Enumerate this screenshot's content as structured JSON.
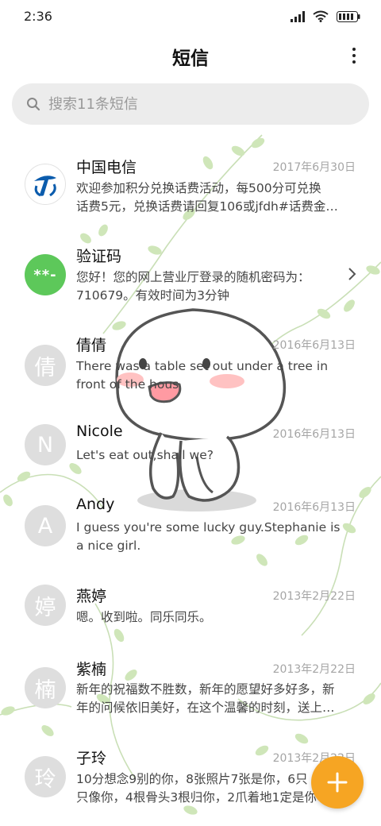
{
  "status": {
    "time": "2:36"
  },
  "header": {
    "title": "短信"
  },
  "search": {
    "placeholder": "搜索11条短信"
  },
  "colors": {
    "accent": "#f6a523",
    "verification": "#5dc85a",
    "avatar_gray": "#dedede"
  },
  "messages": [
    {
      "name": "中国电信",
      "date": "2017年6月30日",
      "line1": "欢迎参加积分兑换话费活动，每500分可兑换",
      "line2": "话费5元，兑换话费请回复106或jfdh#话费金…",
      "avatar": "china-telecom-logo"
    },
    {
      "name": "验证码",
      "date": "",
      "line1": "您好！您的网上营业厅登录的随机密码为：",
      "line2": "710679。有效时间为3分钟",
      "avatar": "**-"
    },
    {
      "name": "倩倩",
      "date": "2016年6月13日",
      "line1": "There was a table set out under a tree in",
      "line2": "front of the hous",
      "avatar": "倩"
    },
    {
      "name": "Nicole",
      "date": "2016年6月13日",
      "line1": "Let's eat out,shall we?",
      "line2": "",
      "avatar": "N"
    },
    {
      "name": "Andy",
      "date": "2016年6月13日",
      "line1": "I guess you're some lucky guy.Stephanie is",
      "line2": "a nice girl.",
      "avatar": "A"
    },
    {
      "name": "燕婷",
      "date": "2013年2月22日",
      "line1": "嗯。收到啦。同乐同乐。",
      "line2": "",
      "avatar": "婷"
    },
    {
      "name": "紫楠",
      "date": "2013年2月22日",
      "line1": "新年的祝福数不胜数，新年的愿望好多好多，新",
      "line2": "年的问候依旧美好，在这个温馨的时刻，送上…",
      "avatar": "楠"
    },
    {
      "name": "子玲",
      "date": "2013年2月22日",
      "line1": "10分想念9别的你，8张照片7张是你，6只",
      "line2": "只像你，4根骨头3根归你，2爪着地1定是你",
      "avatar": "玲"
    }
  ]
}
